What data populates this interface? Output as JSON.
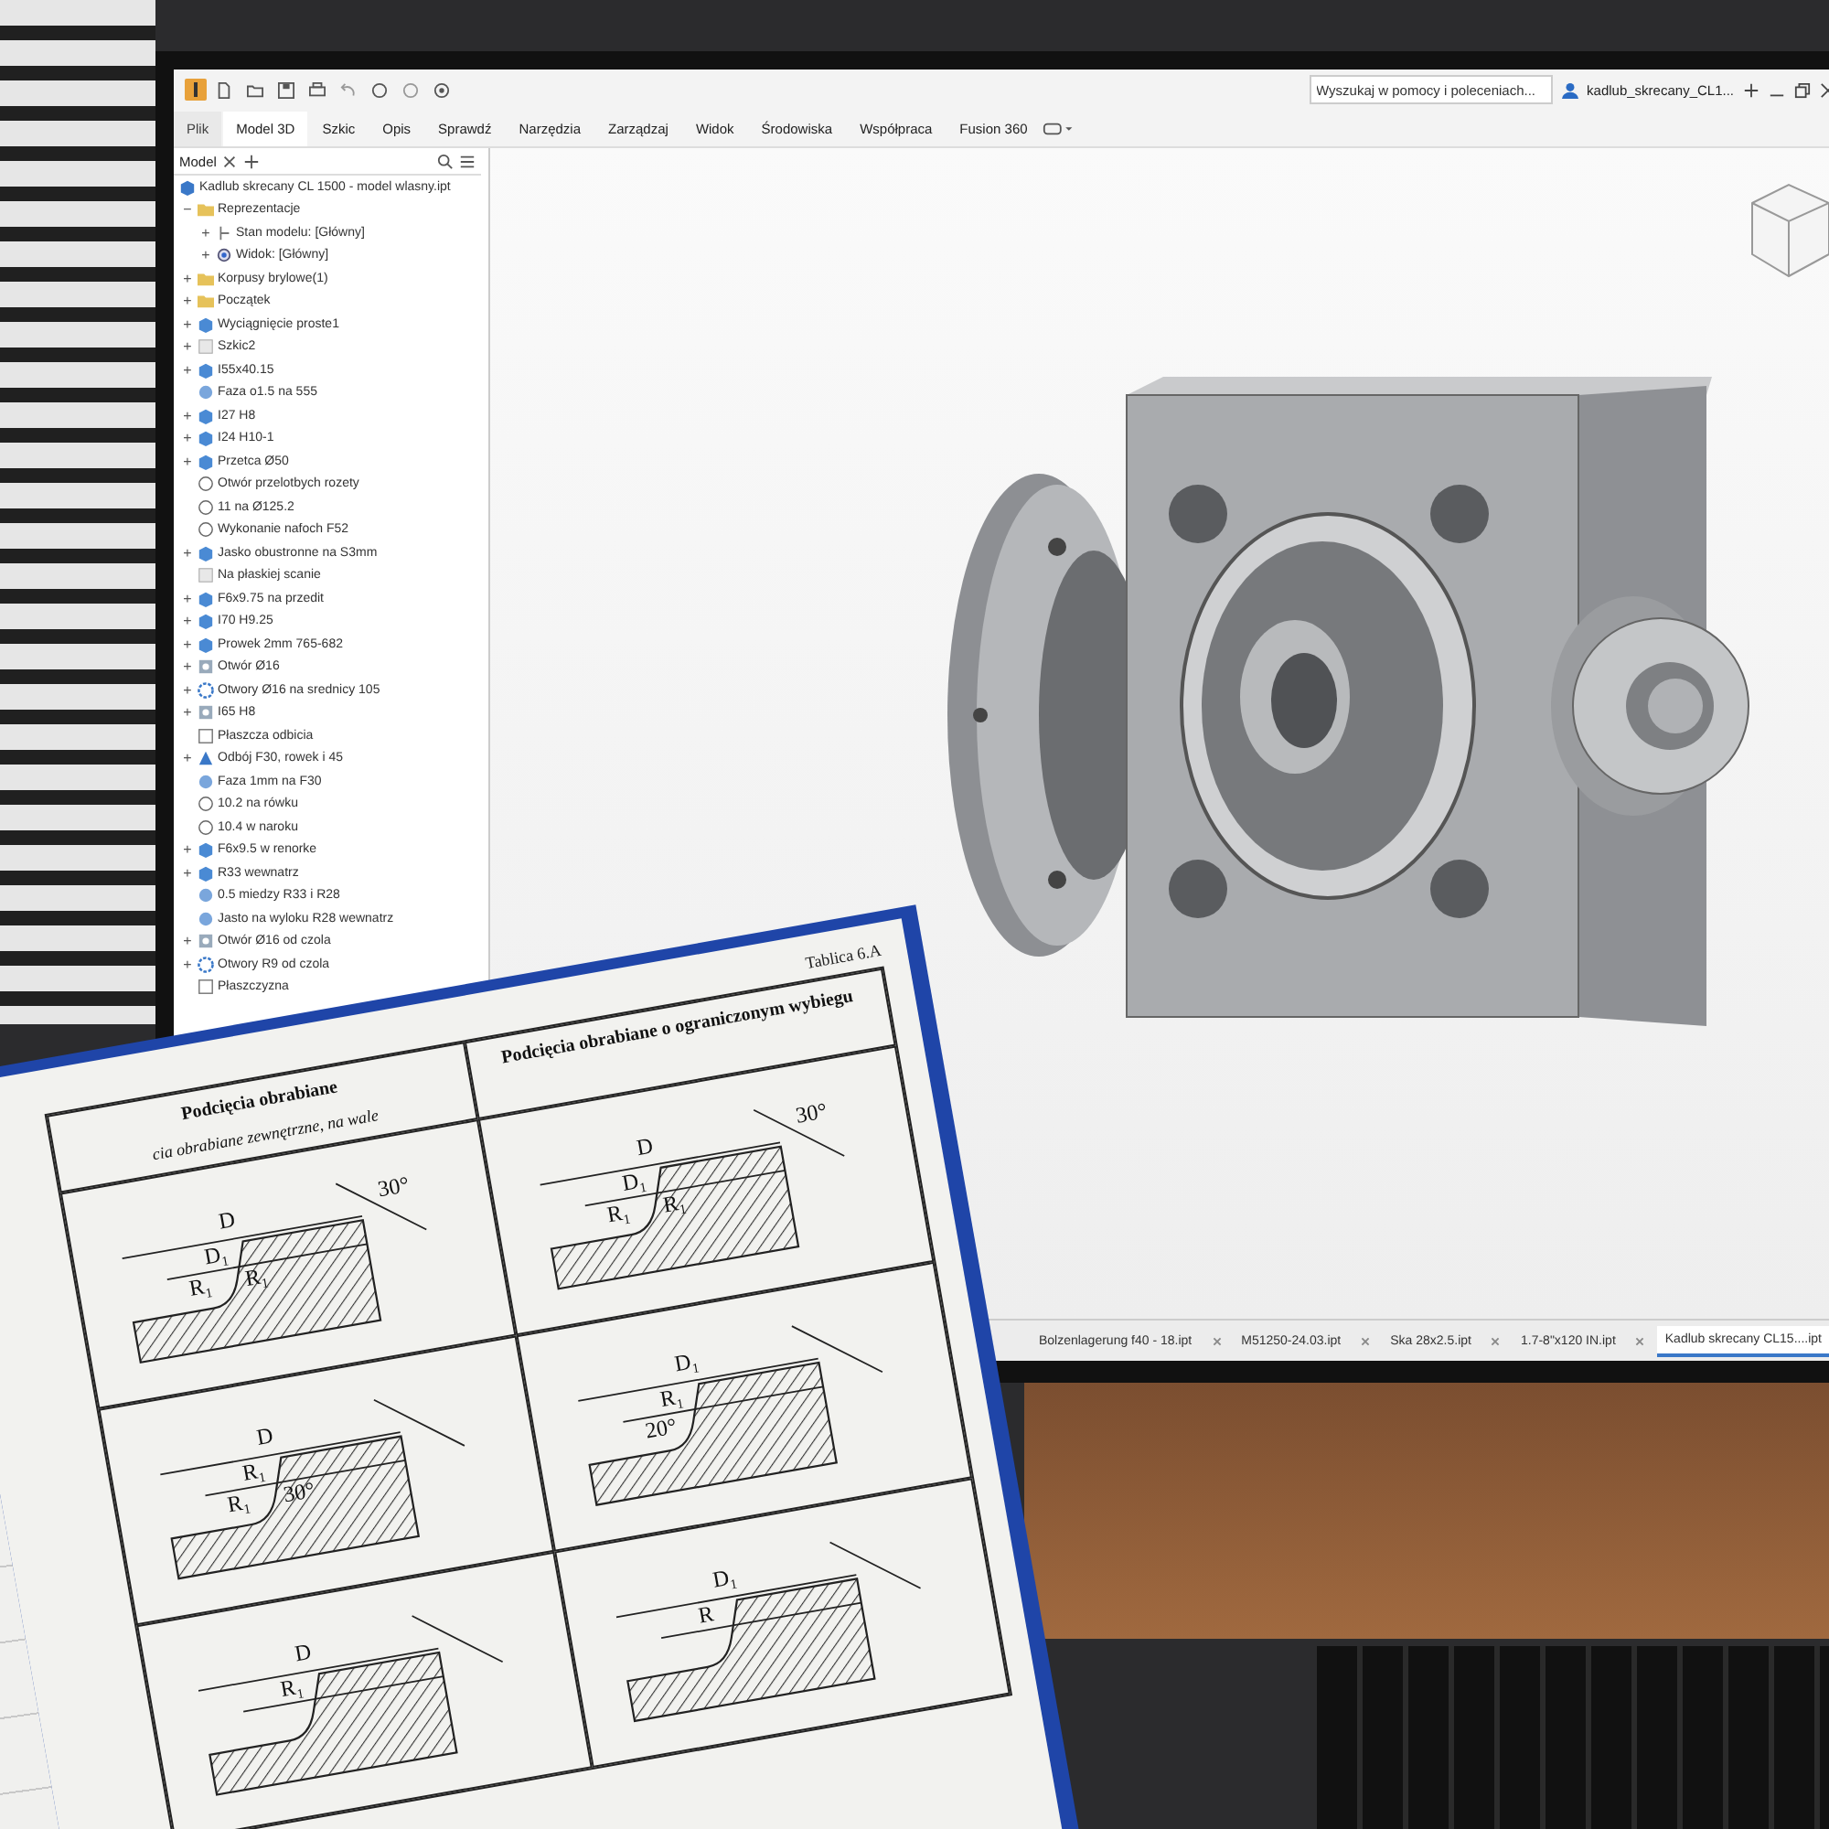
{
  "toolbar": {
    "search": {
      "placeholder": "Wyszukaj w pomocy i poleceniach..."
    },
    "user": "kadlub_skrecany_CL1..."
  },
  "ribbon_tabs": [
    {
      "label": "Plik",
      "kind": "file",
      "selected": false
    },
    {
      "label": "Model 3D",
      "kind": "tab",
      "selected": true
    },
    {
      "label": "Szkic",
      "kind": "tab",
      "selected": false
    },
    {
      "label": "Opis",
      "kind": "tab",
      "selected": false
    },
    {
      "label": "Sprawdź",
      "kind": "tab",
      "selected": false
    },
    {
      "label": "Narzędzia",
      "kind": "tab",
      "selected": false
    },
    {
      "label": "Zarządzaj",
      "kind": "tab",
      "selected": false
    },
    {
      "label": "Widok",
      "kind": "tab",
      "selected": false
    },
    {
      "label": "Środowiska",
      "kind": "tab",
      "selected": false
    },
    {
      "label": "Współpraca",
      "kind": "tab",
      "selected": false
    },
    {
      "label": "Fusion 360",
      "kind": "tab",
      "selected": false
    }
  ],
  "browser": {
    "tab": "Model",
    "root": "Kadlub skrecany CL 1500 - model wlasny.ipt",
    "items": [
      {
        "label": "Reprezentacje",
        "kind": "folder",
        "toggle": "−",
        "children": [
          {
            "label": "Stan modelu: [Główny]",
            "kind": "state",
            "toggle": "+"
          },
          {
            "label": "Widok: [Główny]",
            "kind": "view",
            "toggle": "+"
          }
        ]
      },
      {
        "label": "Korpusy brylowe(1)",
        "kind": "folder",
        "toggle": "+"
      },
      {
        "label": "Początek",
        "kind": "folder",
        "toggle": "+"
      },
      {
        "label": "Wyciągnięcie proste1",
        "kind": "feature",
        "toggle": "+"
      },
      {
        "label": "Szkic2",
        "kind": "sketch",
        "toggle": "+"
      },
      {
        "label": "I55x40.15",
        "kind": "feature",
        "toggle": "+"
      },
      {
        "label": "Faza o1.5 na 555",
        "kind": "fillet"
      },
      {
        "label": "I27 H8",
        "kind": "feature",
        "toggle": "+"
      },
      {
        "label": "I24 H10-1",
        "kind": "feature",
        "toggle": "+"
      },
      {
        "label": "Przetca Ø50",
        "kind": "feature",
        "toggle": "+"
      },
      {
        "label": "Otwór przelotbych rozety",
        "kind": "outline"
      },
      {
        "label": "11 na Ø125.2",
        "kind": "outline"
      },
      {
        "label": "Wykonanie nafoch F52",
        "kind": "outline"
      },
      {
        "label": "Jasko obustronne na S3mm",
        "kind": "feature",
        "toggle": "+"
      },
      {
        "label": "Na płaskiej scanie",
        "kind": "sketch"
      },
      {
        "label": "F6x9.75 na przedit",
        "kind": "feature",
        "toggle": "+"
      },
      {
        "label": "I70 H9.25",
        "kind": "feature",
        "toggle": "+"
      },
      {
        "label": "Prowek 2mm 765-682",
        "kind": "feature",
        "toggle": "+"
      },
      {
        "label": "Otwór Ø16",
        "kind": "hole",
        "toggle": "+"
      },
      {
        "label": "Otwory Ø16 na srednicy 105",
        "kind": "pattern",
        "toggle": "+"
      },
      {
        "label": "I65 H8",
        "kind": "hole",
        "toggle": "+"
      },
      {
        "label": "Płaszcza odbicia",
        "kind": "plane"
      },
      {
        "label": "Odbój F30, rowek i 45",
        "kind": "mirror",
        "toggle": "+"
      },
      {
        "label": "Faza 1mm na F30",
        "kind": "fillet"
      },
      {
        "label": "10.2 na rówku",
        "kind": "outline"
      },
      {
        "label": "10.4 w naroku",
        "kind": "outline"
      },
      {
        "label": "F6x9.5 w renorke",
        "kind": "feature",
        "toggle": "+"
      },
      {
        "label": "R33 wewnatrz",
        "kind": "feature",
        "toggle": "+"
      },
      {
        "label": "0.5 miedzy R33 i R28",
        "kind": "fillet"
      },
      {
        "label": "Jasto na wyloku R28 wewnatrz",
        "kind": "fillet"
      },
      {
        "label": "Otwór Ø16 od czola",
        "kind": "hole",
        "toggle": "+"
      },
      {
        "label": "Otwory R9 od czola",
        "kind": "pattern",
        "toggle": "+"
      },
      {
        "label": "Płaszczyzna",
        "kind": "plane"
      }
    ]
  },
  "document_tabs": [
    {
      "label": "Bolzenlagerung f40 - 18.ipt",
      "selected": false
    },
    {
      "label": "M51250-24.03.ipt",
      "selected": false
    },
    {
      "label": "Ska 28x2.5.ipt",
      "selected": false
    },
    {
      "label": "1.7-8\"x120 IN.ipt",
      "selected": false
    },
    {
      "label": "Kadlub skrecany CL15....ipt",
      "selected": true
    }
  ],
  "book": {
    "table_number": "Tablica 6.A",
    "left_heading": "Podcięcia obrabiane",
    "left_subheading": "cia obrabiane zewnętrzne, na wale",
    "right_heading": "Podcięcia obrabiane o ograniczonym wybiegu",
    "cells": [
      {
        "labels": [
          "D",
          "D₁",
          "R₁",
          "R₁",
          "30°"
        ]
      },
      {
        "labels": [
          "D",
          "D₁",
          "R₁",
          "R₁",
          "30°"
        ]
      },
      {
        "labels": [
          "D",
          "R₁",
          "R₁",
          "30°"
        ]
      },
      {
        "labels": [
          "D₁",
          "R₁",
          "20°"
        ]
      },
      {
        "labels": [
          "D",
          "R₁"
        ]
      },
      {
        "labels": [
          "D₁",
          "R"
        ]
      }
    ]
  }
}
